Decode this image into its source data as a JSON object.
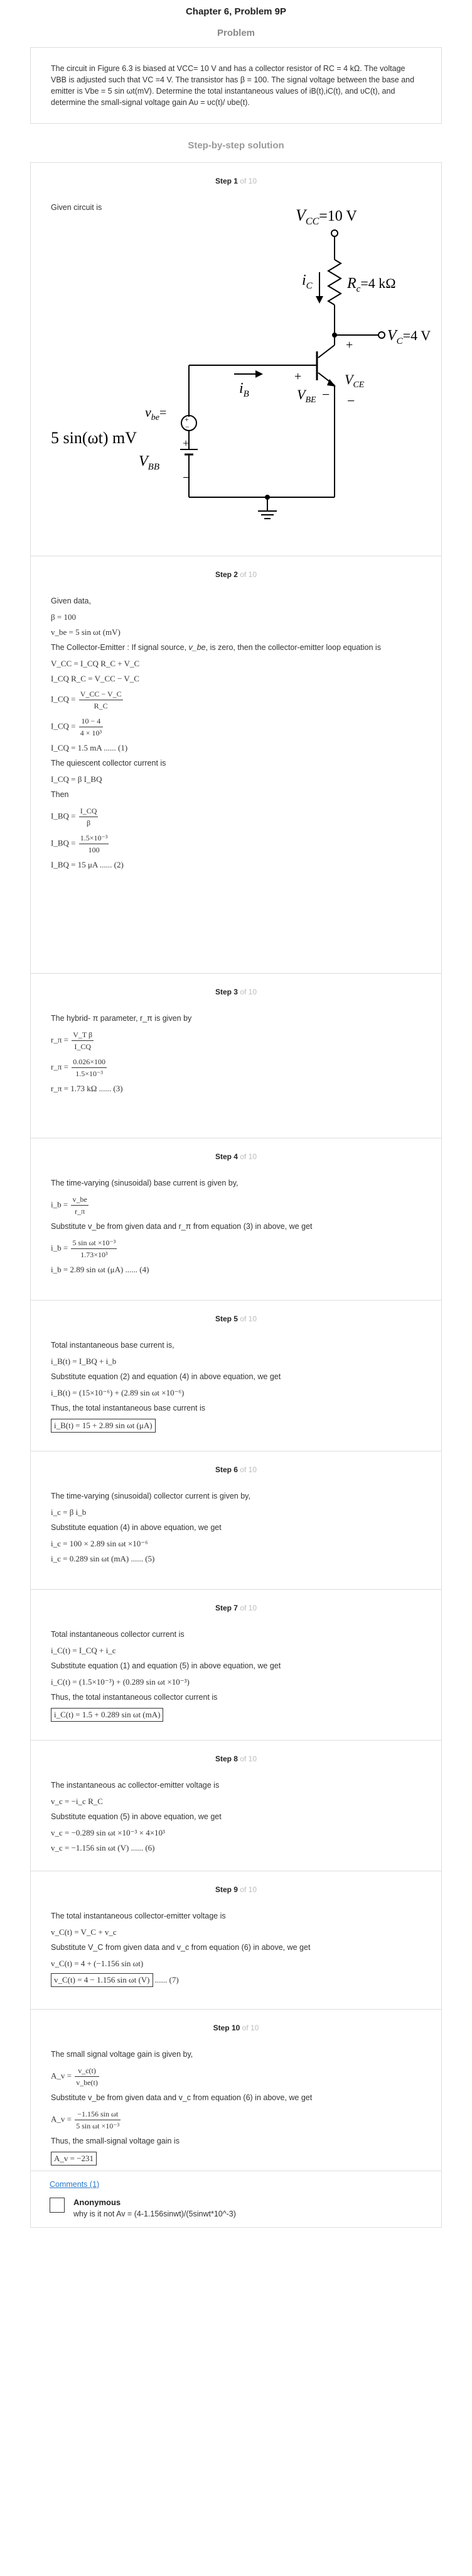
{
  "header": {
    "chapter": "Chapter 6, Problem 9P",
    "problem_label": "Problem"
  },
  "problem": {
    "text": "The circuit in Figure 6.3 is biased at VCC= 10 V and has a collector resistor of RC = 4 kΩ. The voltage VBB is adjusted such that VC =4 V. The transistor has β = 100. The signal voltage between the base and emitter is Vbe = 5 sin ωt(mV). Determine the total instantaneous values of iB(t),iC(t), and υC(t), and determine the small-signal voltage gain Aυ = υc(t)/ υbe(t)."
  },
  "solution_label": "Step-by-step solution",
  "steps_total": "of 10",
  "steps": [
    {
      "label": "Step 1",
      "text": "Given circuit is"
    },
    {
      "label": "Step 2"
    },
    {
      "label": "Step 3"
    },
    {
      "label": "Step 4"
    },
    {
      "label": "Step 5"
    },
    {
      "label": "Step 6"
    },
    {
      "label": "Step 7"
    },
    {
      "label": "Step 8"
    },
    {
      "label": "Step 9"
    },
    {
      "label": "Step 10"
    }
  ],
  "circuit": {
    "vcc": "V",
    "vcc_sub": "CC",
    "vcc_val": "=10 V",
    "ic": "i",
    "ic_sub": "C",
    "rc": "R",
    "rc_sub": "c",
    "rc_val": "=4 kΩ",
    "vc": "V",
    "vc_sub": "C",
    "vc_val": "=4 V",
    "vce": "V",
    "vce_sub": "CE",
    "ib": "i",
    "ib_sub": "B",
    "vbe_small": "v",
    "vbe_small_sub": "be",
    "vbe_small_val": "=",
    "vsrc": "5 sin(ωt) mV",
    "vbe": "V",
    "vbe_sub": "BE",
    "vbb": "V",
    "vbb_sub": "BB"
  },
  "s2": {
    "t1": "Given data,",
    "e1": "β = 100",
    "e2": "v_be = 5 sin ωt (mV)",
    "t2a": "The Collector-Emitter : If signal source,",
    "t2b": "v_be",
    "t2c": ", is zero, then the collector-emitter loop equation is",
    "e3": "V_CC = I_CQ R_C + V_C",
    "e4": "I_CQ R_C = V_CC − V_C",
    "e5l": "I_CQ =",
    "e5n": "V_CC − V_C",
    "e5d": "R_C",
    "e6l": "I_CQ =",
    "e6n": "10 − 4",
    "e6d": "4 × 10³",
    "e7": "I_CQ = 1.5 mA ...... (1)",
    "t3": "The quiescent collector current is",
    "e8": "I_CQ = β I_BQ",
    "t4": "Then",
    "e9l": "I_BQ =",
    "e9n": "I_CQ",
    "e9d": "β",
    "e10l": "I_BQ =",
    "e10n": "1.5×10⁻³",
    "e10d": "100",
    "e11": "I_BQ = 15 μA ...... (2)"
  },
  "s3": {
    "t1": "The hybrid- π parameter, r_π is given by",
    "e1l": "r_π =",
    "e1n": "V_T β",
    "e1d": "I_CQ",
    "e2l": "r_π =",
    "e2n": "0.026×100",
    "e2d": "1.5×10⁻³",
    "e3": "r_π = 1.73 kΩ ...... (3)"
  },
  "s4": {
    "t1": "The time-varying (sinusoidal) base current is given by,",
    "e1l": "i_b =",
    "e1n": "v_be",
    "e1d": "r_π",
    "t2": "Substitute  v_be  from given data and  r_π  from equation (3) in above, we get",
    "e2l": "i_b =",
    "e2n": "5 sin ωt ×10⁻³",
    "e2d": "1.73×10³",
    "e3": "i_b = 2.89 sin ωt (μA) ...... (4)"
  },
  "s5": {
    "t1": "Total instantaneous base current is,",
    "e1": "i_B(t) = I_BQ + i_b",
    "t2": "Substitute equation (2) and equation (4) in above equation, we get",
    "e2": "i_B(t) = (15×10⁻⁶) + (2.89 sin ωt ×10⁻⁶)",
    "t3": "Thus, the total instantaneous base current is",
    "e3": "i_B(t) = 15 + 2.89 sin ωt  (μA)"
  },
  "s6": {
    "t1": "The time-varying (sinusoidal) collector current is given by,",
    "e1": "i_c = β i_b",
    "t2": "Substitute equation (4) in above equation, we get",
    "e2": "i_c = 100 × 2.89 sin ωt ×10⁻⁶",
    "e3": "i_c = 0.289 sin ωt (mA) ...... (5)"
  },
  "s7": {
    "t1": "Total instantaneous collector current is",
    "e1": "i_C(t) = I_CQ + i_c",
    "t2": "Substitute equation (1) and equation (5) in above equation, we get",
    "e2": "i_C(t) = (1.5×10⁻³) + (0.289 sin ωt ×10⁻³)",
    "t3": "Thus, the total instantaneous collector current is",
    "e3": "i_C(t) = 1.5 + 0.289 sin ωt  (mA)"
  },
  "s8": {
    "t1": "The instantaneous ac collector-emitter voltage is",
    "e1": "v_c = −i_c R_C",
    "t2": "Substitute equation (5) in above equation, we get",
    "e2": "v_c = −0.289 sin ωt ×10⁻³ × 4×10³",
    "e3": "v_c = −1.156 sin ωt (V) ...... (6)"
  },
  "s9": {
    "t1": "The total instantaneous collector-emitter voltage is",
    "e1": "v_C(t) = V_C + v_c",
    "t2": "Substitute  V_C  from given data and  v_c  from equation (6) in above, we get",
    "e2": "v_C(t) = 4 + (−1.156 sin ωt)",
    "e3": "v_C(t) = 4 − 1.156 sin ωt  (V)",
    "e3s": "...... (7)"
  },
  "s10": {
    "t1": "The small signal voltage gain is given by,",
    "e1l": "A_v =",
    "e1n": "v_c(t)",
    "e1d": "v_be(t)",
    "t2": "Substitute  v_be  from given data and  v_c  from equation (6) in above, we get",
    "e2l": "A_v =",
    "e2n": "−1.156 sin ωt",
    "e2d": "5 sin ωt ×10⁻³",
    "t3": "Thus, the small-signal voltage gain is",
    "e3": "A_v = −231"
  },
  "comments": {
    "link": "Comments (1)",
    "name": "Anonymous",
    "text": "why is it not Av = (4-1.156sinwt)/(5sinwt*10^-3)"
  }
}
